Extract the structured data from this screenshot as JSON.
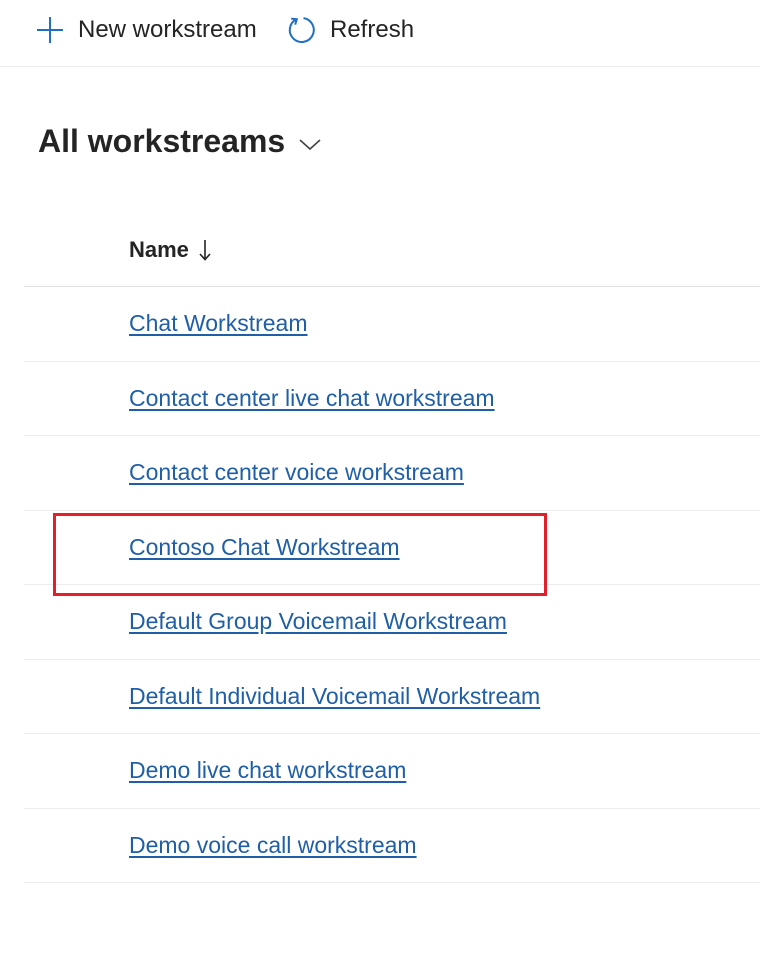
{
  "commandbar": {
    "new_label": "New workstream",
    "new_icon": "plus-icon",
    "refresh_label": "Refresh",
    "refresh_icon": "refresh-icon"
  },
  "view": {
    "title": "All workstreams",
    "chevron_icon": "chevron-down-icon"
  },
  "grid": {
    "columns": [
      {
        "label": "Name",
        "sort": "descending",
        "sort_icon": "arrow-down-icon"
      }
    ],
    "rows": [
      {
        "name": "Chat  Workstream"
      },
      {
        "name": "Contact center live chat workstream"
      },
      {
        "name": "Contact center voice workstream"
      },
      {
        "name": "Contoso Chat Workstream",
        "highlighted": true
      },
      {
        "name": "Default Group Voicemail Workstream"
      },
      {
        "name": "Default Individual Voicemail Workstream"
      },
      {
        "name": "Demo live chat workstream"
      },
      {
        "name": "Demo voice call workstream"
      }
    ]
  },
  "colors": {
    "link": "#1f5ea8",
    "icon_accent": "#1f6fc6",
    "highlight": "#e3202a",
    "text": "#242424"
  }
}
